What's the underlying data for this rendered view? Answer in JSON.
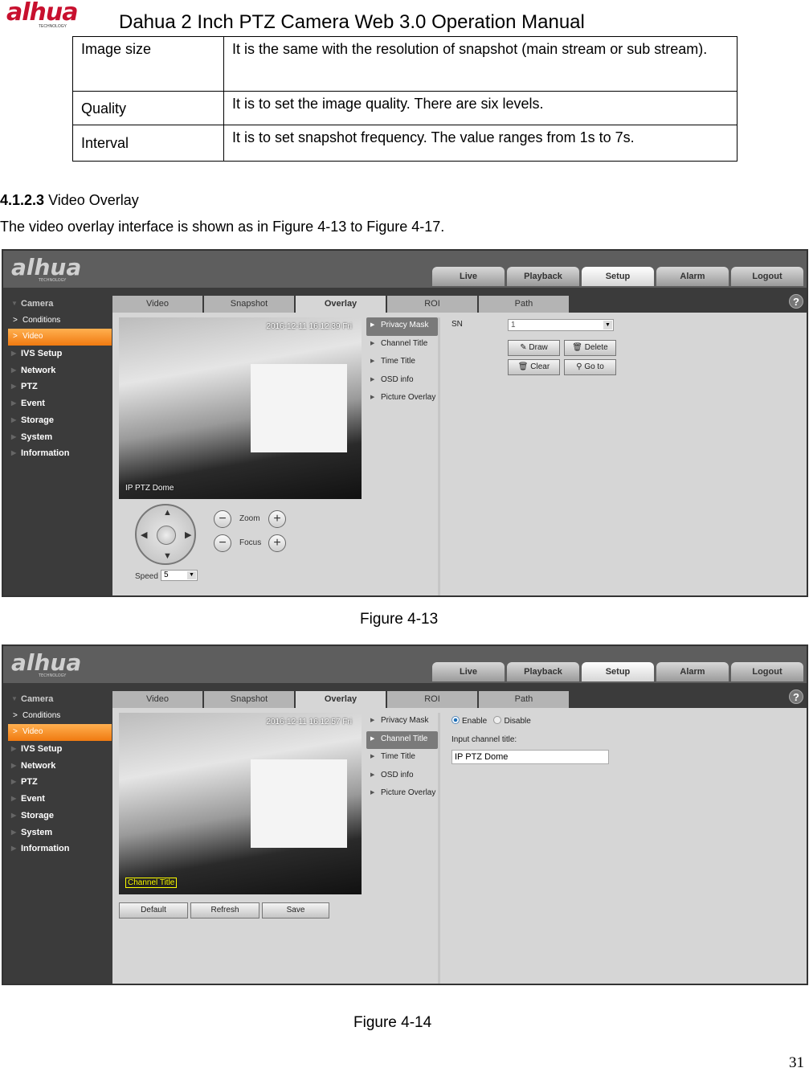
{
  "header": {
    "logo_text": "alhua",
    "logo_subtext": "TECHNOLOGY",
    "title": "Dahua 2 Inch PTZ Camera Web 3.0 Operation Manual"
  },
  "param_table": {
    "rows": [
      {
        "param": "Image size",
        "desc": "It is the same with the resolution of snapshot (main stream or sub stream)."
      },
      {
        "param": "Quality",
        "desc": "It is to set the image quality. There are six levels."
      },
      {
        "param": "Interval",
        "desc": "It is to set snapshot frequency. The value ranges from 1s to 7s."
      }
    ]
  },
  "section": {
    "number": "4.1.2.3",
    "title": "Video Overlay"
  },
  "intro": "The video overlay interface is shown as in Figure 4-13 to Figure 4-17.",
  "ui": {
    "logo_text": "alhua",
    "logo_subtext": "TECHNOLOGY",
    "nav": [
      "Live",
      "Playback",
      "Setup",
      "Alarm",
      "Logout"
    ],
    "nav_active": "Setup",
    "sidebar": {
      "camera": "Camera",
      "conditions": "Conditions",
      "video": "Video",
      "items": [
        "IVS Setup",
        "Network",
        "PTZ",
        "Event",
        "Storage",
        "System",
        "Information"
      ]
    },
    "tabs": [
      "Video",
      "Snapshot",
      "Overlay",
      "ROI",
      "Path"
    ],
    "tab_active": "Overlay",
    "help_icon": "?",
    "submenu": [
      "Privacy Mask",
      "Channel Title",
      "Time Title",
      "OSD info",
      "Picture Overlay"
    ]
  },
  "fig1": {
    "timestamp": "2016-12-11 16:12:39 Fri",
    "channel_overlay": "IP PTZ Dome",
    "selected_submenu": "Privacy Mask",
    "sn_label": "SN",
    "sn_value": "1",
    "buttons": {
      "draw": "Draw",
      "delete": "Delete",
      "clear": "Clear",
      "goto": "Go to"
    },
    "ptz": {
      "zoom": "Zoom",
      "focus": "Focus",
      "speed_label": "Speed",
      "speed_value": "5"
    },
    "caption": "Figure 4-13"
  },
  "fig2": {
    "timestamp": "2016-12-11 16:12:57 Fri",
    "channel_overlay": "Channel Title",
    "selected_submenu": "Channel Title",
    "enable_label": "Enable",
    "disable_label": "Disable",
    "enabled": true,
    "input_label": "Input channel title:",
    "input_value": "IP PTZ Dome",
    "buttons": {
      "default": "Default",
      "refresh": "Refresh",
      "save": "Save"
    },
    "caption": "Figure 4-14"
  },
  "page_number": "31"
}
